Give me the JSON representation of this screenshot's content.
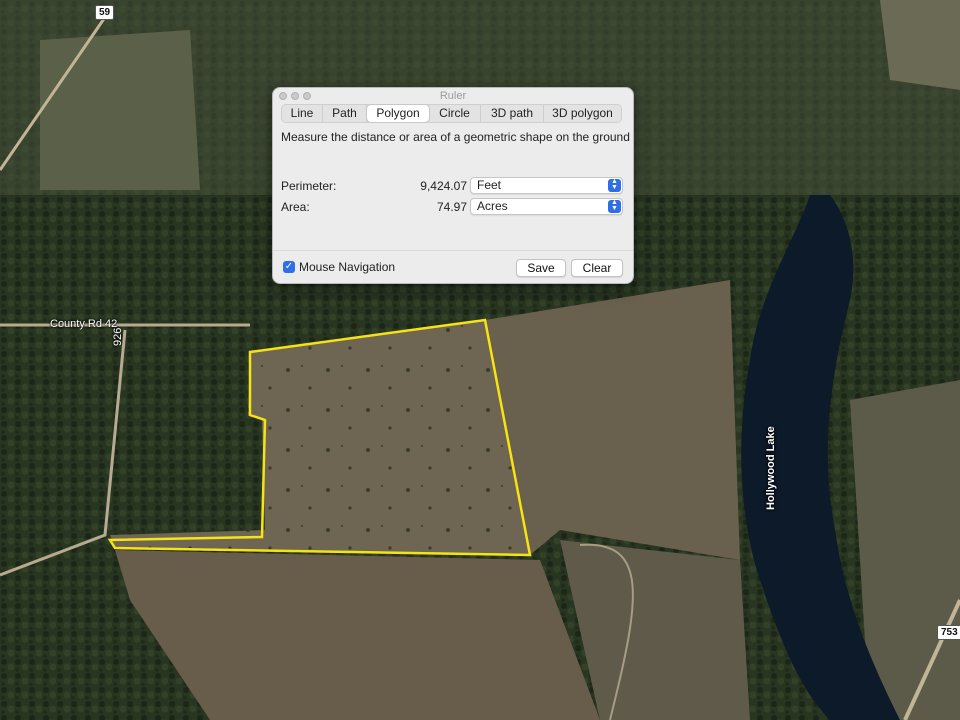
{
  "window": {
    "title": "Ruler"
  },
  "tabs": [
    {
      "label": "Line",
      "active": false
    },
    {
      "label": "Path",
      "active": false
    },
    {
      "label": "Polygon",
      "active": true
    },
    {
      "label": "Circle",
      "active": false
    },
    {
      "label": "3D path",
      "active": false
    },
    {
      "label": "3D polygon",
      "active": false
    }
  ],
  "description": "Measure the distance or area of a geometric shape on the ground",
  "measurements": {
    "perimeter": {
      "label": "Perimeter:",
      "value": "9,424.07",
      "unit": "Feet"
    },
    "area": {
      "label": "Area:",
      "value": "74.97",
      "unit": "Acres"
    }
  },
  "footer": {
    "mouse_navigation_label": "Mouse Navigation",
    "mouse_navigation_checked": true,
    "save_label": "Save",
    "clear_label": "Clear"
  },
  "map": {
    "road_label": "County Rd 42",
    "road_vertical_label": "926",
    "shield_59": "59",
    "shield_753": "753",
    "lake_label": "Hollywood Lake",
    "polygon_color": "#f5e313"
  },
  "colors": {
    "accent": "#2e6ee8"
  }
}
